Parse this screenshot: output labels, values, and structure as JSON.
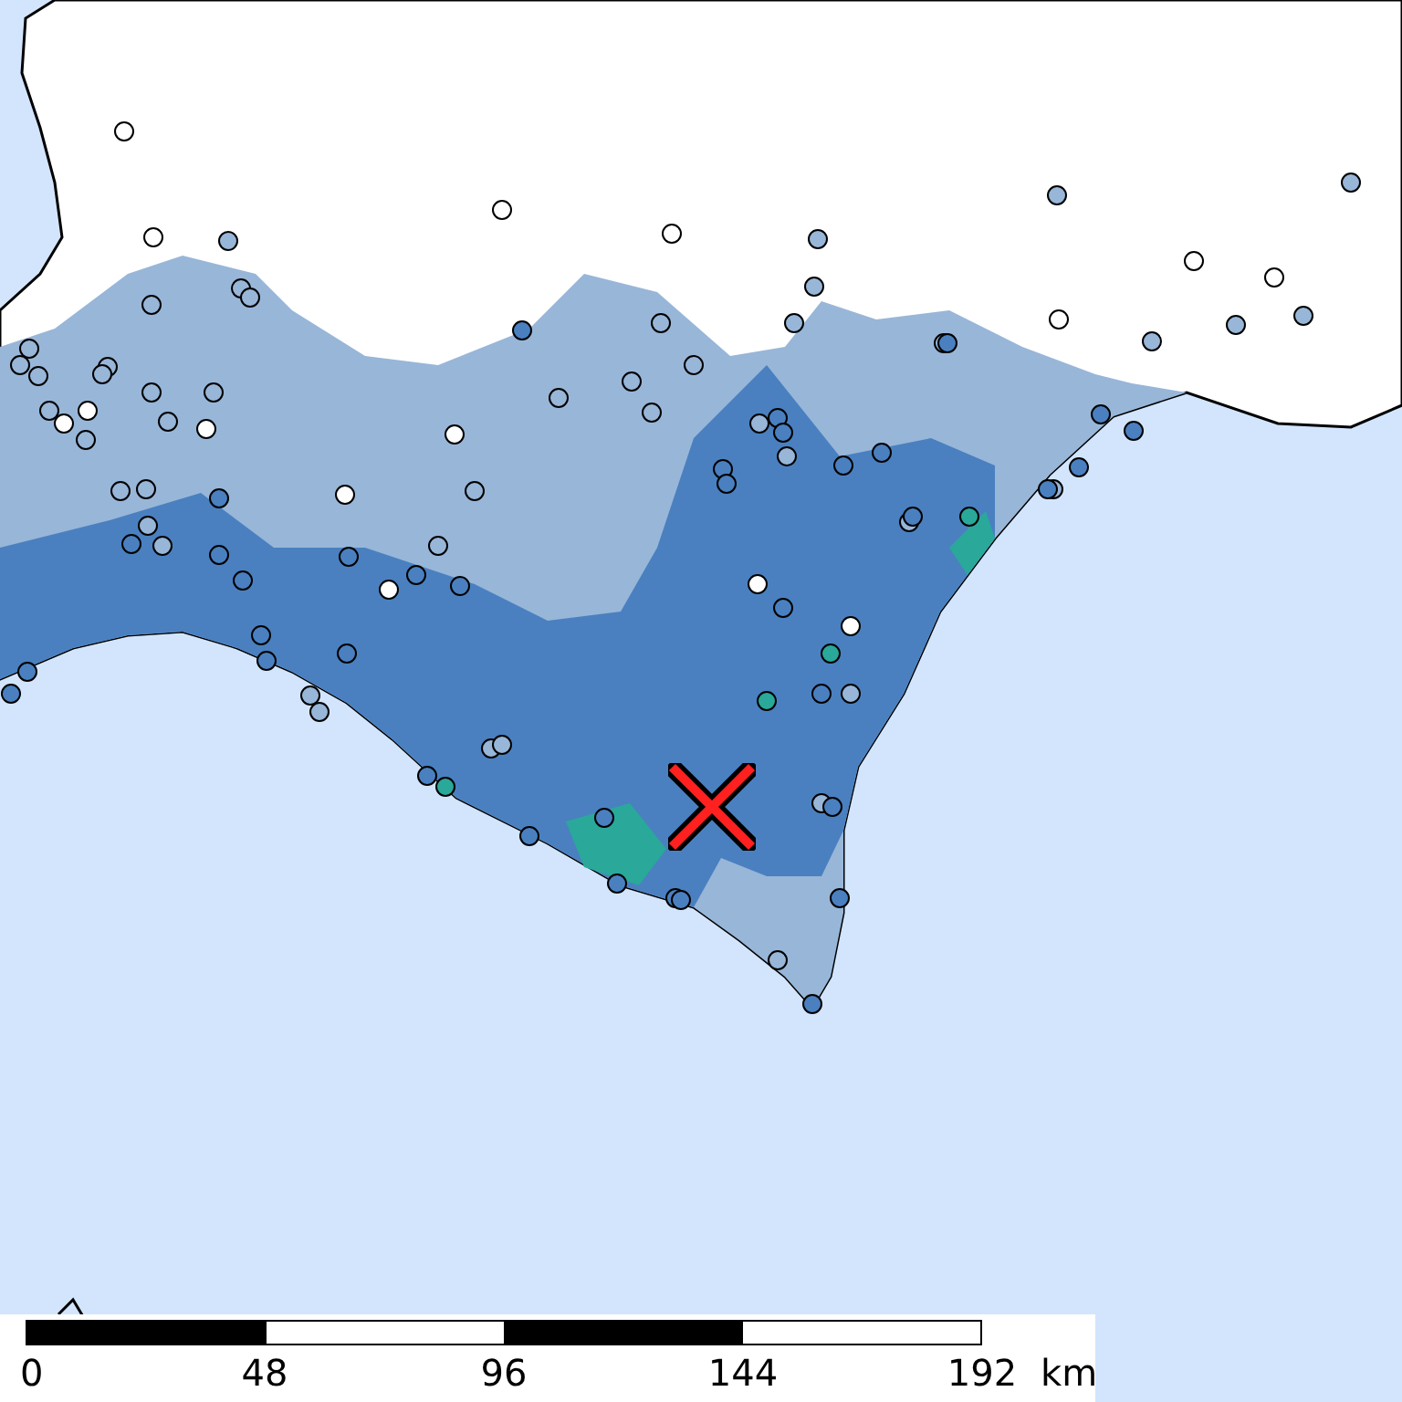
{
  "scale_bar": {
    "ticks": [
      "0",
      "48",
      "96",
      "144",
      "192"
    ],
    "unit": "km"
  }
}
